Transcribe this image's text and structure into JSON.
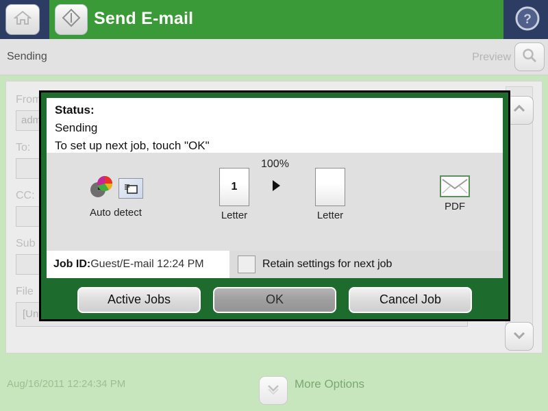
{
  "header": {
    "title": "Send E-mail",
    "home_icon": "home-icon",
    "start_icon": "start-diamond-icon",
    "help_icon": "help-question-icon"
  },
  "subheader": {
    "status": "Sending",
    "preview_label": "Preview",
    "preview_icon": "magnifier-icon"
  },
  "form": {
    "fields": [
      {
        "label": "From:",
        "value": "adm"
      },
      {
        "label": "To:",
        "value": ""
      },
      {
        "label": "CC:",
        "value": ""
      },
      {
        "label": "Sub",
        "value": ""
      },
      {
        "label": "File",
        "value": "[Untitled]"
      }
    ],
    "scroll_up_icon": "chevron-up-icon",
    "scroll_down_icon": "chevron-down-icon"
  },
  "dialog": {
    "status_label": "Status",
    "status_colon": ":",
    "status_value": "Sending",
    "instruction": "To set up next job, touch \"OK\"",
    "summary": {
      "color_mode_caption": "Auto detect",
      "color_wheel_icon": "color-wheel-icon",
      "scanner_icon": "scanner-glass-icon",
      "source_page_number": "1",
      "source_caption": "Letter",
      "scale_percent": "100%",
      "arrow_icon": "arrow-right-icon",
      "output_caption": "Letter",
      "file_type_caption": "PDF",
      "file_type_icon": "envelope-icon"
    },
    "job_id_label": "Job ID",
    "job_id_colon": ":",
    "job_id_value": "Guest/E-mail 12:24 PM",
    "retain_label": "Retain settings for next job",
    "retain_checked": false,
    "buttons": [
      {
        "label": "Active Jobs",
        "pressed": false
      },
      {
        "label": "OK",
        "pressed": true
      },
      {
        "label": "Cancel Job",
        "pressed": false
      }
    ]
  },
  "bottom": {
    "timestamp": "Aug/16/2011 12:24:34 PM",
    "more_options_label": "More Options",
    "more_options_icon": "chevron-double-down-icon"
  },
  "colors": {
    "header_green": "#3a9a38",
    "header_navy": "#2c3c63",
    "dialog_green": "#1d6b2d",
    "page_background": "#c8e6bd"
  }
}
